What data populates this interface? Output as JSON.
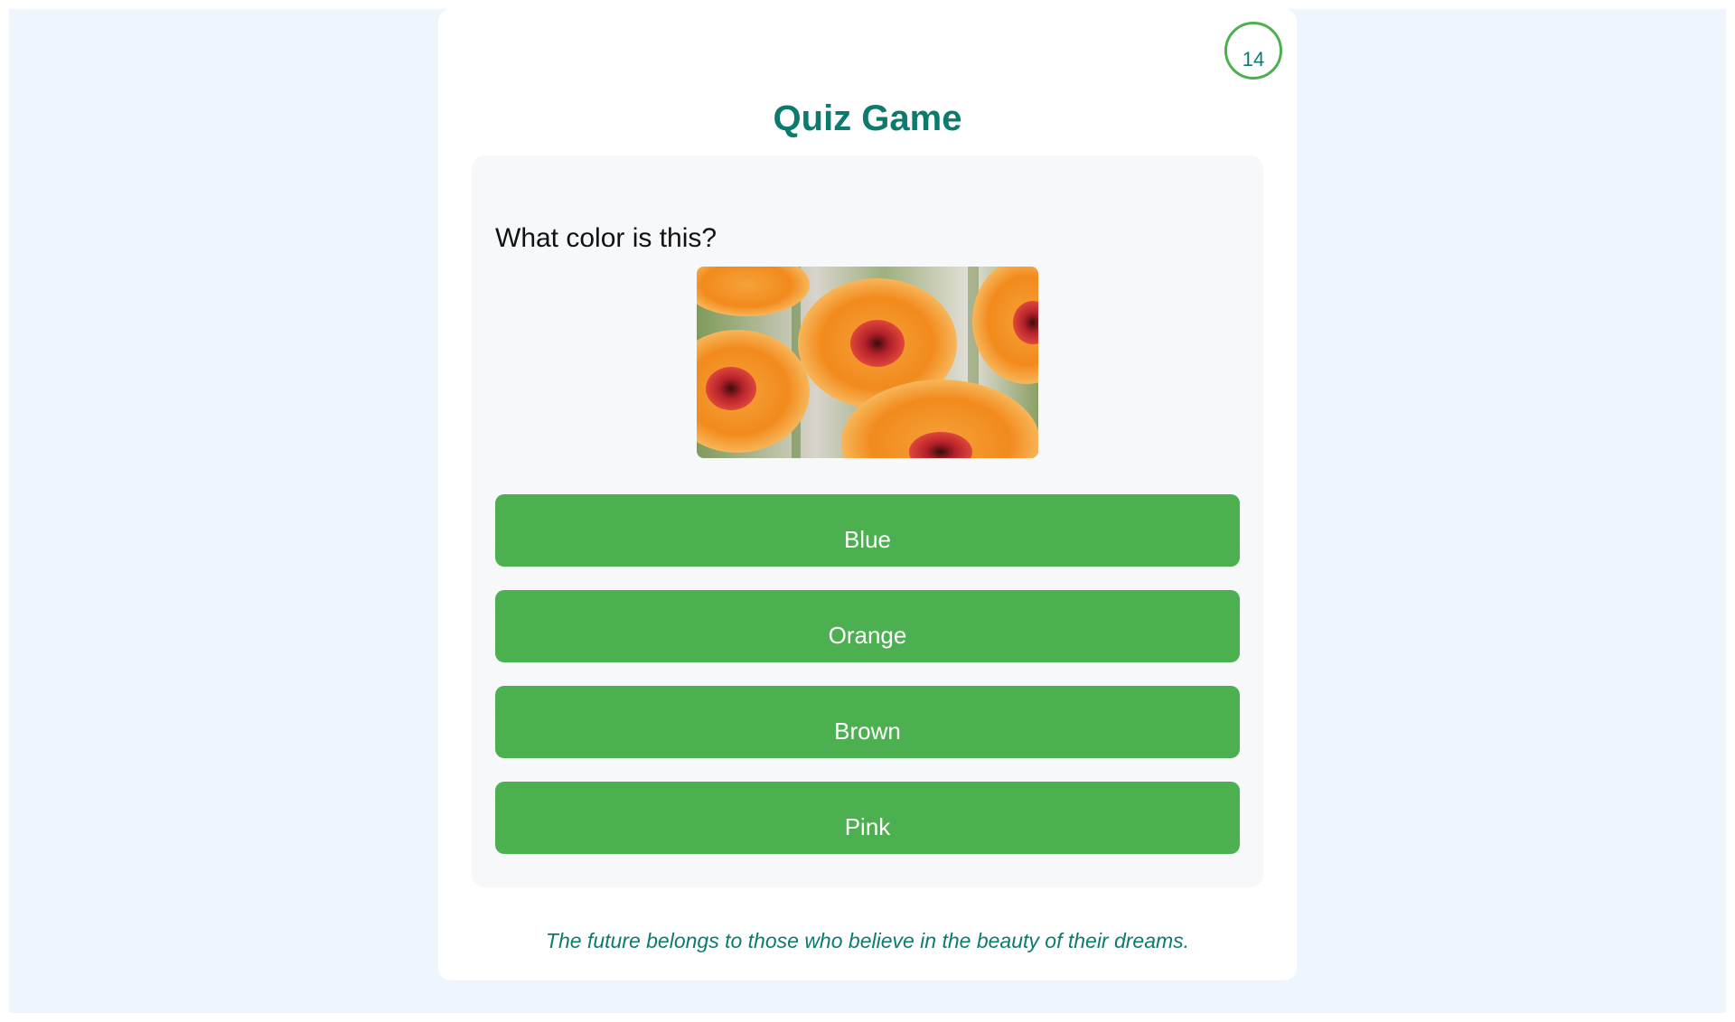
{
  "app": {
    "title": "Quiz Game",
    "timer": "14"
  },
  "question": {
    "text": "What color is this?",
    "image_subject": "orange gerbera daisies"
  },
  "options": [
    {
      "label": "Blue"
    },
    {
      "label": "Orange"
    },
    {
      "label": "Brown"
    },
    {
      "label": "Pink"
    }
  ],
  "footer": {
    "quote": "The future belongs to those who believe in the beauty of their dreams."
  },
  "colors": {
    "accent": "#0d7a6e",
    "button": "#4caf50",
    "page_background": "#eef5fd",
    "panel": "#f6f8fa"
  }
}
